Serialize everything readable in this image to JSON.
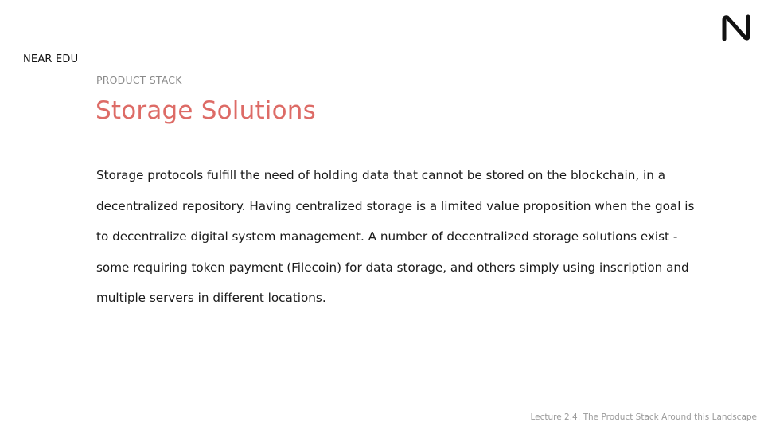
{
  "header": {
    "brand_label": "NEAR EDU",
    "logo_icon": "near-logo-icon"
  },
  "slide": {
    "section_label": "PRODUCT STACK",
    "title": "Storage Solutions",
    "body": "Storage protocols fulfill the need of holding data that cannot be stored on the blockchain, in a decentralized repository. Having centralized storage is a limited value proposition when the goal is to decentralize digital system management. A number of decentralized storage solutions exist - some requiring token payment (Filecoin) for data storage, and others simply using inscription and multiple servers in different locations."
  },
  "footer": {
    "lecture": "Lecture 2.4: The Product Stack Around this Landscape"
  },
  "colors": {
    "title_accent": "#dd6b66",
    "muted_text": "#8a8a8a",
    "text": "#1a1a1a"
  }
}
